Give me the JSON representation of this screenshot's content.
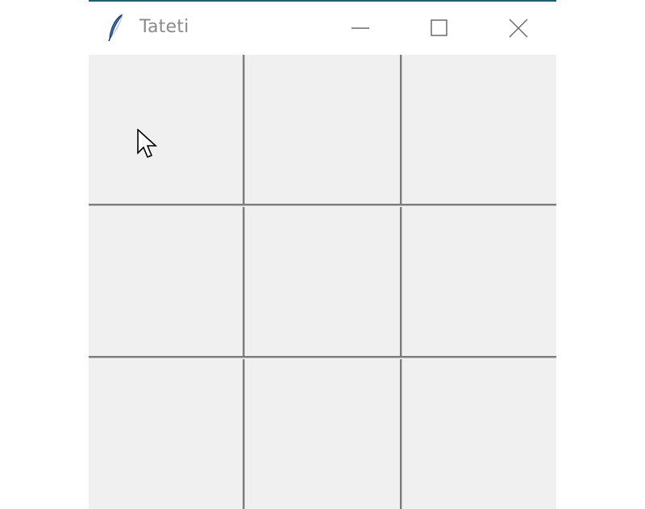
{
  "window": {
    "title": "Tateti",
    "app_icon": "feather-icon",
    "controls": {
      "minimize_icon": "minimize-icon",
      "maximize_icon": "maximize-icon",
      "close_icon": "close-icon"
    },
    "accent_color": "#1f5e6e"
  },
  "board": {
    "rows": 3,
    "cols": 3,
    "cells": [
      "",
      "",
      "",
      "",
      "",
      "",
      "",
      "",
      ""
    ],
    "cell_color": "#f0f0f0"
  },
  "cursor": {
    "icon": "arrow-cursor-icon"
  }
}
